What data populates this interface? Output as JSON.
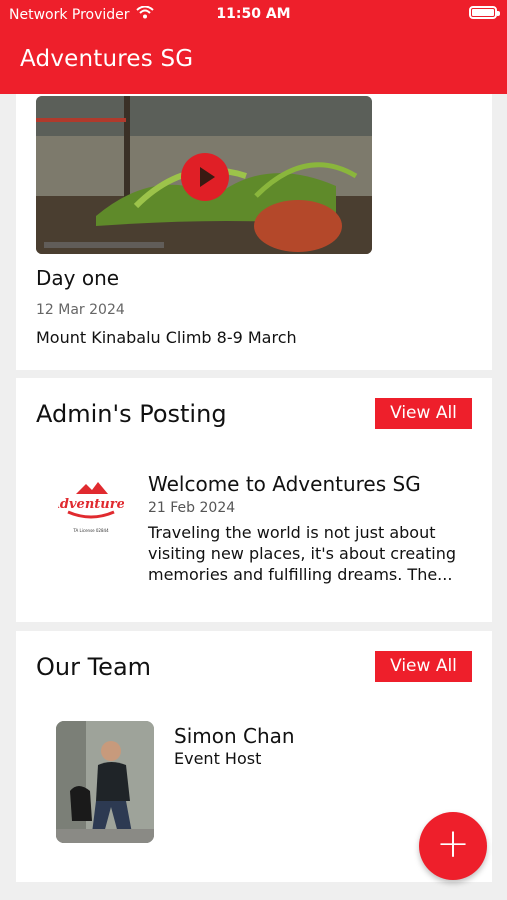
{
  "status_bar": {
    "carrier": "Network Provider",
    "time": "11:50 AM",
    "icons": [
      "wifi-icon",
      "battery-icon"
    ]
  },
  "header": {
    "title": "Adventures SG"
  },
  "featured_post": {
    "title": "Day one",
    "date": "12 Mar 2024",
    "description": "Mount Kinabalu Climb 8-9 March",
    "media_icon": "play-icon"
  },
  "admin_section": {
    "title": "Admin's Posting",
    "view_all_label": "View All",
    "post": {
      "title": "Welcome to Adventures SG",
      "date": "21 Feb 2024",
      "excerpt": "Traveling the world is not just about visiting new places, it's about creating memories and fulfilling dreams. The...",
      "logo_text": "Adventures",
      "logo_license": "TA License 02844"
    }
  },
  "team_section": {
    "title": "Our Team",
    "view_all_label": "View All",
    "member": {
      "name": "Simon Chan",
      "role": "Event Host"
    }
  },
  "fab": {
    "label": "+",
    "icon": "plus-icon"
  },
  "colors": {
    "brand_red": "#ee1f2b",
    "background": "#efefef",
    "card": "#ffffff"
  }
}
